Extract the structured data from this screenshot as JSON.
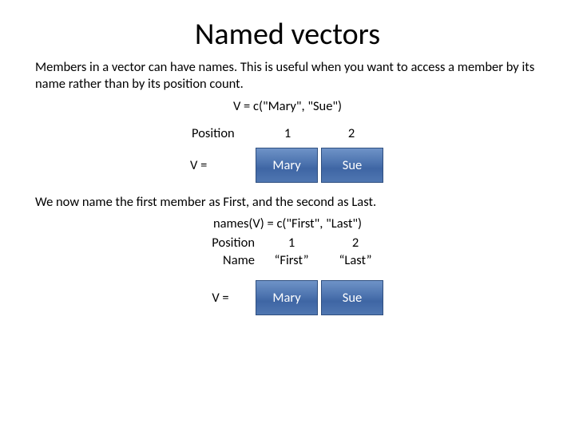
{
  "title": "Named vectors",
  "intro": "Members in a vector can have names. This is useful when you want to access a member by its name rather than by its position count.",
  "code1": "V = c(\"Mary\", \"Sue\")",
  "diagram1": {
    "posLabel": "Position",
    "positions": [
      "1",
      "2"
    ],
    "vLabel": "V =",
    "values": [
      "Mary",
      "Sue"
    ]
  },
  "para2": "We now name the first member as First, and the second as Last.",
  "code2": "names(V) = c(\"First\", \"Last\")",
  "table2": {
    "posLabel": "Position",
    "positions": [
      "1",
      "2"
    ],
    "nameLabel": "Name",
    "names": [
      "“First”",
      "“Last”"
    ]
  },
  "diagram2": {
    "vLabel": "V =",
    "values": [
      "Mary",
      "Sue"
    ]
  }
}
